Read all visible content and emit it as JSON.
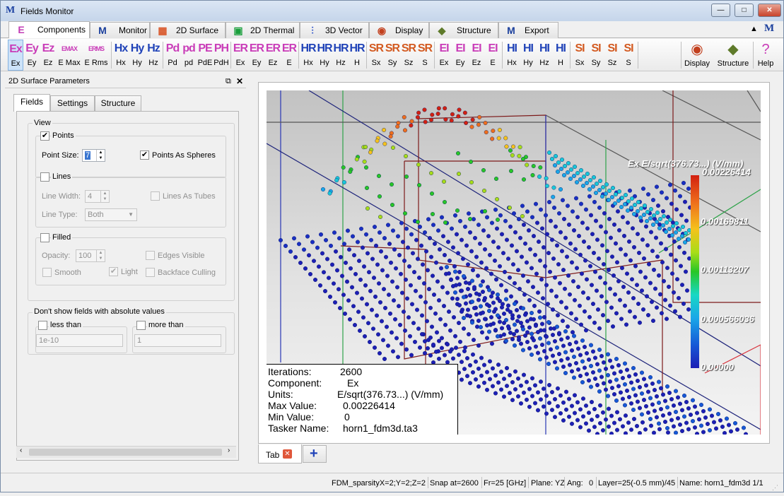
{
  "window": {
    "title": "Fields Monitor",
    "minimize_glyph": "—",
    "maximize_glyph": "□",
    "close_glyph": "✕"
  },
  "main_tabs": [
    {
      "label": "Components",
      "icon": "E",
      "icon_color": "#c23bb5"
    },
    {
      "label": "Monitor",
      "icon": "M",
      "icon_color": "#1b3f9c"
    },
    {
      "label": "2D Surface",
      "icon": "▦",
      "icon_color": "#d9572a"
    },
    {
      "label": "2D Thermal",
      "icon": "▣",
      "icon_color": "#1a9f3c"
    },
    {
      "label": "3D Vector",
      "icon": "⫶",
      "icon_color": "#2a4fc9"
    },
    {
      "label": "Display",
      "icon": "◉",
      "icon_color": "#c2401e"
    },
    {
      "label": "Structure",
      "icon": "◆",
      "icon_color": "#5e7a2a"
    },
    {
      "label": "Export",
      "icon": "M",
      "icon_color": "#1b3f9c"
    }
  ],
  "toolbar": {
    "groups": [
      {
        "color": "#c93cb8",
        "items": [
          {
            "glyph": "Ex",
            "label": "Ex"
          },
          {
            "glyph": "Ey",
            "label": "Ey"
          },
          {
            "glyph": "Ez",
            "label": "Ez"
          },
          {
            "glyph": "EMAX",
            "label": "E Max"
          },
          {
            "glyph": "ERMS",
            "label": "E Rms"
          }
        ]
      },
      {
        "color": "#2043b8",
        "items": [
          {
            "glyph": "Hx",
            "label": "Hx"
          },
          {
            "glyph": "Hy",
            "label": "Hy"
          },
          {
            "glyph": "Hz",
            "label": "Hz"
          }
        ]
      },
      {
        "color": "#c93cb8",
        "items": [
          {
            "glyph": "Pd",
            "label": "Pd"
          },
          {
            "glyph": "pd",
            "label": "pd"
          },
          {
            "glyph": "PE",
            "label": "PdE"
          },
          {
            "glyph": "PH",
            "label": "PdH"
          }
        ]
      },
      {
        "color": "#c93cb8",
        "items": [
          {
            "glyph": "ER",
            "label": "Ex"
          },
          {
            "glyph": "ER",
            "label": "Ey"
          },
          {
            "glyph": "ER",
            "label": "Ez"
          },
          {
            "glyph": "ER",
            "label": "E"
          }
        ]
      },
      {
        "color": "#2043b8",
        "items": [
          {
            "glyph": "HR",
            "label": "Hx"
          },
          {
            "glyph": "HR",
            "label": "Hy"
          },
          {
            "glyph": "HR",
            "label": "Hz"
          },
          {
            "glyph": "HR",
            "label": "H"
          }
        ]
      },
      {
        "color": "#d35a20",
        "items": [
          {
            "glyph": "SR",
            "label": "Sx"
          },
          {
            "glyph": "SR",
            "label": "Sy"
          },
          {
            "glyph": "SR",
            "label": "Sz"
          },
          {
            "glyph": "SR",
            "label": "S"
          }
        ]
      },
      {
        "color": "#c93cb8",
        "items": [
          {
            "glyph": "EI",
            "label": "Ex"
          },
          {
            "glyph": "EI",
            "label": "Ey"
          },
          {
            "glyph": "EI",
            "label": "Ez"
          },
          {
            "glyph": "EI",
            "label": "E"
          }
        ]
      },
      {
        "color": "#2043b8",
        "items": [
          {
            "glyph": "HI",
            "label": "Hx"
          },
          {
            "glyph": "HI",
            "label": "Hy"
          },
          {
            "glyph": "HI",
            "label": "Hz"
          },
          {
            "glyph": "HI",
            "label": "H"
          }
        ]
      },
      {
        "color": "#d35a20",
        "items": [
          {
            "glyph": "SI",
            "label": "Sx"
          },
          {
            "glyph": "SI",
            "label": "Sy"
          },
          {
            "glyph": "SI",
            "label": "Sz"
          },
          {
            "glyph": "SI",
            "label": "S"
          }
        ]
      }
    ],
    "display_label": "Display",
    "structure_label": "Structure",
    "help_label": "Help"
  },
  "panel": {
    "title": "2D Surface Parameters",
    "tabs": [
      "Fields",
      "Settings",
      "Structure"
    ],
    "view_group": "View",
    "points_label": "Points",
    "point_size_label": "Point Size:",
    "point_size_value": "7",
    "points_as_spheres_label": "Points As Spheres",
    "lines_label": "Lines",
    "line_width_label": "Line Width:",
    "line_width_value": "4",
    "lines_as_tubes_label": "Lines As Tubes",
    "line_type_label": "Line Type:",
    "line_type_value": "Both",
    "filled_label": "Filled",
    "opacity_label": "Opacity:",
    "opacity_value": "100",
    "edges_visible_label": "Edges Visible",
    "smooth_label": "Smooth",
    "light_label": "Light",
    "backface_culling_label": "Backface Culling",
    "abs_group": "Don't show fields with absolute values",
    "less_than_label": "less than",
    "less_than_value": "1e-10",
    "more_than_label": "more than",
    "more_than_value": "1"
  },
  "viewport": {
    "legend_title": "Ex E/sqrt(376.73...) (V/mm)",
    "legend_values": [
      "0.00226414",
      "0.00169811",
      "0.00113207",
      "0.000566036",
      "0.00000"
    ],
    "info": [
      {
        "key": "Iterations:",
        "value": "2600"
      },
      {
        "key": "Component:",
        "value": "Ex"
      },
      {
        "key": "Units:",
        "value": "E/sqrt(376.73...) (V/mm)"
      },
      {
        "key": "Max Value:",
        "value": "0.00226414"
      },
      {
        "key": "Min Value:",
        "value": "0"
      },
      {
        "key": "Tasker Name:",
        "value": "horn1_fdm3d.ta3"
      }
    ]
  },
  "bottom_tabs": {
    "tab_label": "Tab",
    "add_glyph": "+"
  },
  "status": {
    "sparsity": "FDM_sparsityX=2;Y=2;Z=2",
    "snap": "Snap at=2600",
    "freq": "Fr=25 [GHz]",
    "plane": "Plane: YZ",
    "ang": "Ang:",
    "ang_value": "0",
    "layer": "Layer=25(-0.5 mm)/45",
    "name": "Name: horn1_fdm3d 1/1"
  }
}
